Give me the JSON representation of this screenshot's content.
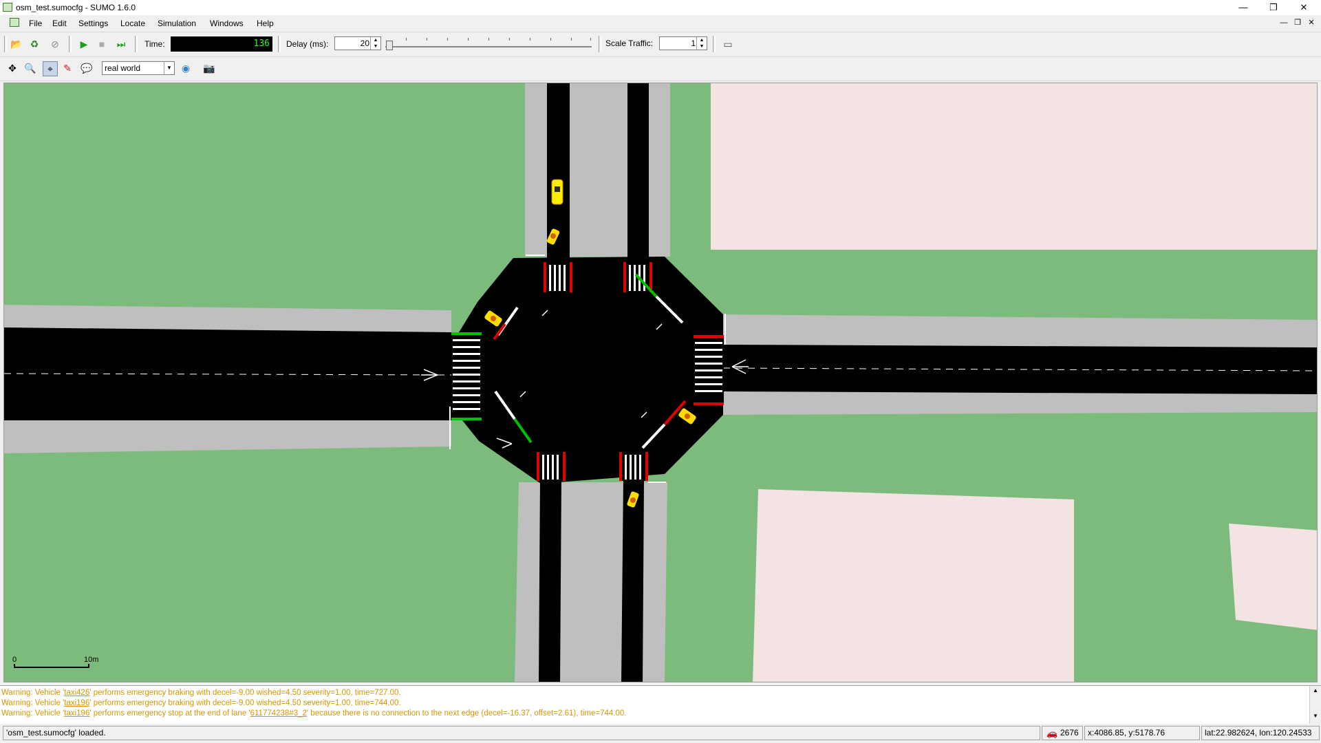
{
  "window": {
    "title": "osm_test.sumocfg - SUMO 1.6.0",
    "min_glyph": "—",
    "max_glyph": "❐",
    "close_glyph": "✕"
  },
  "menu": {
    "items": [
      "File",
      "Edit",
      "Settings",
      "Locate",
      "Simulation",
      "Windows",
      "Help"
    ],
    "mdi_min_glyph": "—",
    "mdi_restore_glyph": "❐",
    "mdi_close_glyph": "✕"
  },
  "toolbar": {
    "open_icon": "📂",
    "reload_icon": "♻",
    "close_sim_icon": "⊘",
    "run_icon": "▶",
    "stop_icon": "■",
    "step_icon": "⏭",
    "time_label": "Time:",
    "time_value": "136",
    "delay_label": "Delay (ms):",
    "delay_value": "20",
    "scale_label": "Scale Traffic:",
    "scale_value": "1",
    "new_view_icon": "▭"
  },
  "view_toolbar": {
    "recenter_icon": "✥",
    "zoom_icon": "🔍",
    "locate_icon": "⌖",
    "select_icon": "✎",
    "tooltip_icon": "💬",
    "scheme_value": "real world",
    "color_icon": "◉",
    "screenshot_icon": "📷"
  },
  "canvas": {
    "scale_left": "0",
    "scale_right": "10m",
    "colors": {
      "grass": "#7cbb7c",
      "road": "#000000",
      "sidewalk": "#bfbfbf",
      "building": "#f3e3e3",
      "crossing_red": "#e00000",
      "crossing_green": "#00c000",
      "vehicle": "#ffee00"
    }
  },
  "messages": {
    "warn1_pre": "Warning: Vehicle '",
    "warn1_link": "taxi426",
    "warn1_post": "' performs emergency braking with decel=-9.00 wished=4.50 severity=1.00, time=727.00.",
    "warn2_pre": "Warning: Vehicle '",
    "warn2_link": "taxi196",
    "warn2_post": "' performs emergency braking with decel=-9.00 wished=4.50 severity=1.00, time=744.00.",
    "warn3_pre": "Warning: Vehicle '",
    "warn3_link": "taxi196",
    "warn3_mid": "' performs emergency stop at the end of lane '",
    "warn3_link2": "611774238#3_2",
    "warn3_post": "' because there is no connection to the next edge (decel=-16.37, offset=2.61), time=744.00."
  },
  "status": {
    "text": "'osm_test.sumocfg' loaded.",
    "vehicle_count": "2676",
    "coords": "x:4086.85, y:5178.76",
    "geo": "lat:22.982624, lon:120.24533"
  }
}
